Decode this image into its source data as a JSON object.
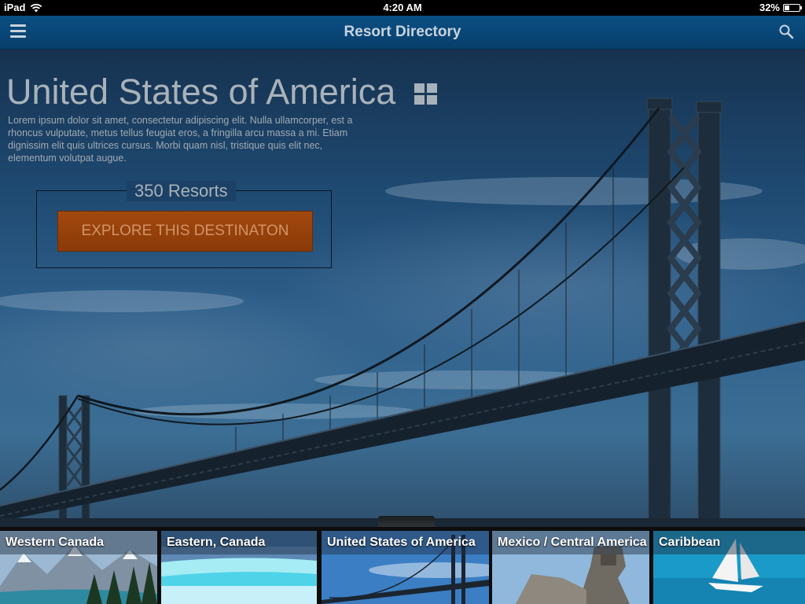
{
  "status_bar": {
    "device": "iPad",
    "time": "4:20 AM",
    "battery": "32%",
    "battery_level": 0.32
  },
  "nav": {
    "title": "Resort Directory",
    "menu_icon": "hamburger-icon",
    "search_icon": "search-icon"
  },
  "hero": {
    "title": "United States of America",
    "description": "Lorem ipsum dolor sit amet, consectetur adipiscing elit. Nulla ullamcorper, est a rhoncus vulputate, metus tellus feugiat eros, a fringilla arcu massa a mi. Etiam dignissim elit quis ultrices cursus. Morbi quam nisl, tristique quis elit nec, elementum volutpat augue.",
    "resort_count": "350 Resorts",
    "cta_label": "EXPLORE THIS DESTINATON"
  },
  "destinations": [
    {
      "label": "Western Canada",
      "selected": false
    },
    {
      "label": "Eastern, Canada",
      "selected": false
    },
    {
      "label": "United States of America",
      "selected": true
    },
    {
      "label": "Mexico / Central America",
      "selected": false
    },
    {
      "label": "Caribbean",
      "selected": false
    }
  ],
  "colors": {
    "accent": "#a6d12a",
    "cta": "#9a420c",
    "navbar": "#0a4f84"
  }
}
